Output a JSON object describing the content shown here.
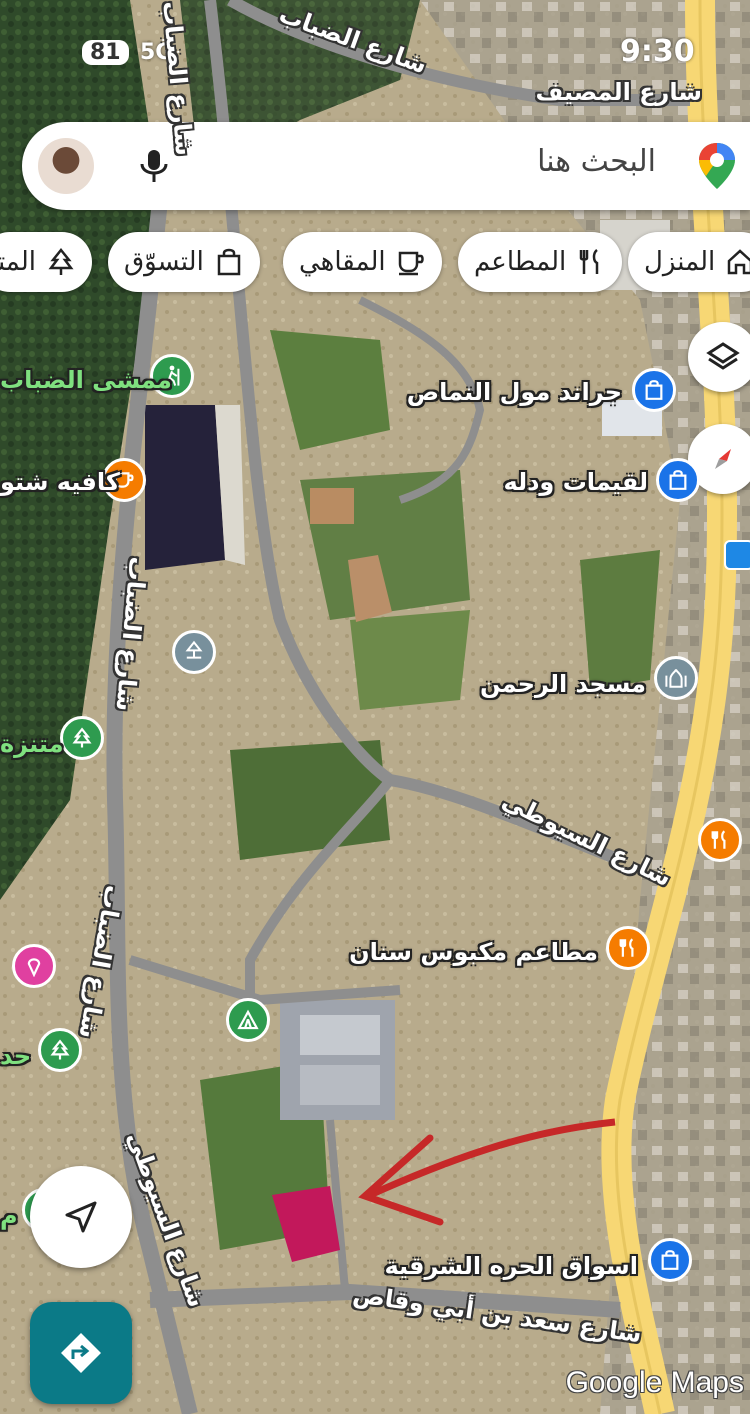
{
  "status_bar": {
    "battery": "81",
    "network": "5G",
    "time": "9:30"
  },
  "search": {
    "placeholder": "البحث هنا"
  },
  "chips": [
    {
      "label": "المنزل",
      "icon": "home-icon"
    },
    {
      "label": "المطاعم",
      "icon": "fork-knife-icon"
    },
    {
      "label": "المقاهي",
      "icon": "coffee-cup-icon"
    },
    {
      "label": "التسوّق",
      "icon": "shopping-bag-icon"
    },
    {
      "label": "المتن",
      "icon": "tree-icon"
    }
  ],
  "places": [
    {
      "name": "جراند مول النماص",
      "category": "shopping",
      "icon": "shopping-bag-icon",
      "color": "#1a73e8"
    },
    {
      "name": "لقيمات ودله",
      "category": "shopping",
      "icon": "shopping-bag-icon",
      "color": "#1a73e8"
    },
    {
      "name": "مسجد الرحمن",
      "category": "mosque",
      "icon": "mosque-icon",
      "color": "#78909c"
    },
    {
      "name": "مطاعم مكبوس سنان",
      "category": "restaurant",
      "icon": "fork-knife-icon",
      "color": "#f57c00"
    },
    {
      "name": "اسواق الحره الشرقية",
      "category": "shopping",
      "icon": "shopping-bag-icon",
      "color": "#1a73e8"
    },
    {
      "name": "ممشى الضباب",
      "category": "hiking",
      "icon": "hiker-icon",
      "color": "#2e9b4f"
    },
    {
      "name": "كافيه شتو",
      "category": "cafe",
      "icon": "coffee-cup-icon",
      "color": "#f57c00"
    },
    {
      "name": "متنزة",
      "category": "park",
      "icon": "tree-icon",
      "color": "#2e9b4f"
    },
    {
      "name": "حد",
      "category": "park",
      "icon": "tree-icon",
      "color": "#2e9b4f"
    },
    {
      "name": "م",
      "category": "park",
      "icon": "tree-icon",
      "color": "#2e9b4f"
    }
  ],
  "roads": [
    {
      "name": "شارع المصيف"
    },
    {
      "name": "شارع الضباب"
    },
    {
      "name": "شارع الضباب"
    },
    {
      "name": "شارع الضباب"
    },
    {
      "name": "شارع الضباب"
    },
    {
      "name": "شارع السيوطي"
    },
    {
      "name": "شارع سعد بن أبي وقاص"
    }
  ],
  "attribution": "Google Maps",
  "colors": {
    "accent": "#1a73e8",
    "directions_button": "#0b7a87",
    "highlight_plot": "#c2185b",
    "arrow": "#c62828"
  }
}
